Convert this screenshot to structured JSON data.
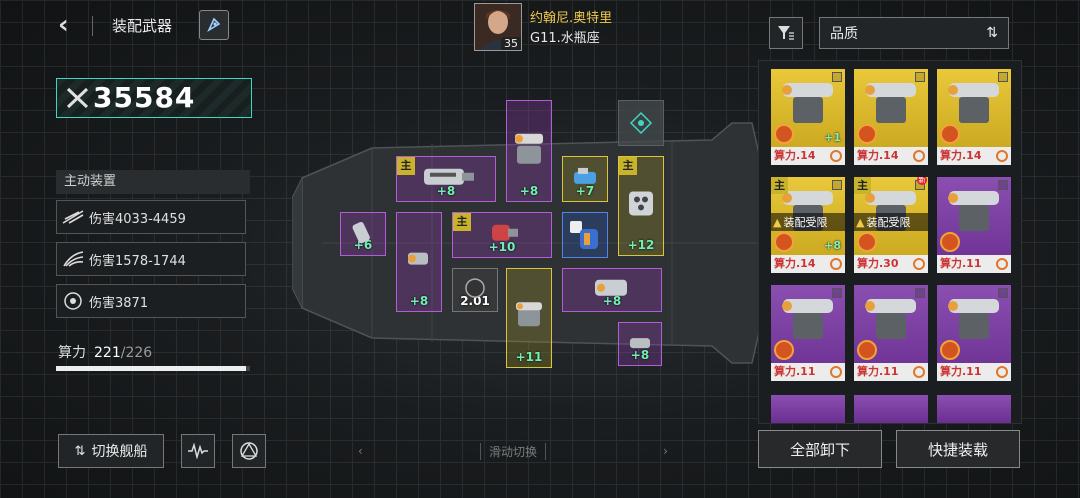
{
  "header": {
    "back_icon": "chevron-left-icon",
    "title": "装配武器",
    "rocket_icon": "rocket-icon"
  },
  "pilot": {
    "name": "约翰尼.奥特里",
    "ship": "G11.水瓶座",
    "level": "35"
  },
  "combat_power": "35584",
  "active_equipment": {
    "header": "主动装置",
    "items": [
      {
        "label": "伤害4033-4459",
        "icon": "slash-icon"
      },
      {
        "label": "伤害1578-1744",
        "icon": "claw-icon"
      },
      {
        "label": "伤害3871",
        "icon": "radial-icon"
      }
    ]
  },
  "cpu": {
    "label": "算力",
    "used": "221",
    "total": "/226",
    "fraction": 0.978
  },
  "bottom": {
    "switch_ship": "切换舰船",
    "slide_hint": "滑动切换",
    "unequip_all": "全部卸下",
    "quick_equip": "快捷装载"
  },
  "slots": [
    {
      "bonus": "+8",
      "main": "主"
    },
    {
      "bonus": "+8",
      "main": ""
    },
    {
      "bonus": "+7",
      "main": ""
    },
    {
      "bonus": "+12",
      "main": "主"
    },
    {
      "bonus": "+6",
      "main": ""
    },
    {
      "bonus": "+8",
      "main": ""
    },
    {
      "bonus": "+10",
      "main": "主"
    },
    {
      "bonus": "",
      "main": ""
    },
    {
      "bonus": "2.01",
      "main": ""
    },
    {
      "bonus": "+11",
      "main": ""
    },
    {
      "bonus": "+8",
      "main": ""
    },
    {
      "bonus": "+8",
      "main": ""
    }
  ],
  "right_panel": {
    "filter_icon": "filter-icon",
    "sort_label": "品质",
    "sort_icon": "sort-arrows-icon",
    "cards": [
      {
        "cpu": "算力.14",
        "plus": "+1",
        "main": "",
        "limit": "",
        "new": false,
        "color": "#e9c83a"
      },
      {
        "cpu": "算力.14",
        "plus": "",
        "main": "",
        "limit": "",
        "new": false,
        "color": "#e9c83a"
      },
      {
        "cpu": "算力.14",
        "plus": "",
        "main": "",
        "limit": "",
        "new": false,
        "color": "#e9c83a"
      },
      {
        "cpu": "算力.14",
        "plus": "+8",
        "main": "主",
        "limit": "装配受限",
        "new": false,
        "color": "#e9c83a"
      },
      {
        "cpu": "算力.30",
        "plus": "",
        "main": "主",
        "limit": "装配受限",
        "new": true,
        "new_label": "新",
        "color": "#e9c83a"
      },
      {
        "cpu": "算力.11",
        "plus": "",
        "main": "",
        "limit": "",
        "new": false,
        "color": "#8a4fb0"
      },
      {
        "cpu": "算力.11",
        "plus": "",
        "main": "",
        "limit": "",
        "new": false,
        "color": "#8a4fb0"
      },
      {
        "cpu": "算力.11",
        "plus": "",
        "main": "",
        "limit": "",
        "new": false,
        "color": "#8a4fb0"
      },
      {
        "cpu": "算力.11",
        "plus": "",
        "main": "",
        "limit": "",
        "new": false,
        "color": "#8a4fb0"
      }
    ]
  },
  "colors": {
    "accent_teal": "#3dd8c1",
    "rarity_gold": "#e9c83a",
    "rarity_purple": "#8a4fb0",
    "bonus_green": "#6ff0b0"
  }
}
